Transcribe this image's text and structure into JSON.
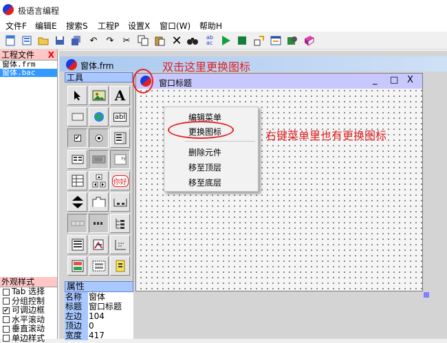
{
  "window": {
    "title": "极语言编程"
  },
  "menu": [
    "文件F",
    "编辑E",
    "搜索S",
    "工程P",
    "设置X",
    "窗口(W)",
    "帮助H"
  ],
  "toolbar_icons": [
    "new-icon",
    "open-project-icon",
    "open-file-icon",
    "save-icon",
    "save-all-icon",
    "undo-icon",
    "redo-icon",
    "cut-icon",
    "copy-icon",
    "paste-icon",
    "delete-icon",
    "find-icon",
    "replace-icon",
    "run-icon",
    "stop-icon",
    "export-icon",
    "form-icon",
    "resources-icon",
    "help-book-icon"
  ],
  "project": {
    "title": "工程文件",
    "close": "X",
    "files": [
      "窗体.frm",
      "窗体.bac"
    ],
    "selected_index": 1
  },
  "document": {
    "title": "窗体.frm"
  },
  "tools": {
    "title": "工具",
    "items": [
      "pointer",
      "picture",
      "label",
      "frame",
      "web",
      "textbox",
      "checkbox",
      "radio",
      "listbox",
      "listview",
      "progress",
      "combobox",
      "grid",
      "spinner",
      "hello-text",
      "scrollbar",
      "tabstrip",
      "statusbar",
      "toolbar-ctl",
      "dotline",
      "treeview",
      "richtext",
      "chart",
      "timer",
      "imagelist",
      "table",
      "file-ctl"
    ],
    "label_text": "A",
    "textbox_text": "abl",
    "hello_text": "你好"
  },
  "style_panel": {
    "title": "外观样式",
    "options": [
      {
        "label": "Tab 选择",
        "checked": false
      },
      {
        "label": "分组控制",
        "checked": false
      },
      {
        "label": "可调边框",
        "checked": true
      },
      {
        "label": "水平滚动",
        "checked": false
      },
      {
        "label": "垂直滚动",
        "checked": false
      },
      {
        "label": "单边样式",
        "checked": false
      }
    ]
  },
  "properties": {
    "title": "属性",
    "rows": [
      {
        "key": "名称",
        "value": "窗体"
      },
      {
        "key": "标题",
        "value": "窗口标题"
      },
      {
        "key": "左边",
        "value": "104"
      },
      {
        "key": "顶边",
        "value": "0"
      },
      {
        "key": "宽度",
        "value": "417"
      }
    ]
  },
  "form": {
    "title": "窗口标题",
    "min": "_",
    "max": "□",
    "close": "X"
  },
  "context_menu": {
    "items": [
      "编辑菜单",
      "更换图标",
      "删除元件",
      "移至顶层",
      "移至底层"
    ]
  },
  "annotations": {
    "top": "双击这里更换图标",
    "right": "右键菜单里也有更换图标"
  },
  "colors": {
    "panel_header": "#ffc6c6",
    "tool_header": "#a8c8ff",
    "form_title": "#c8c8ff",
    "annotation": "#e02020",
    "selection": "#3399ff"
  }
}
